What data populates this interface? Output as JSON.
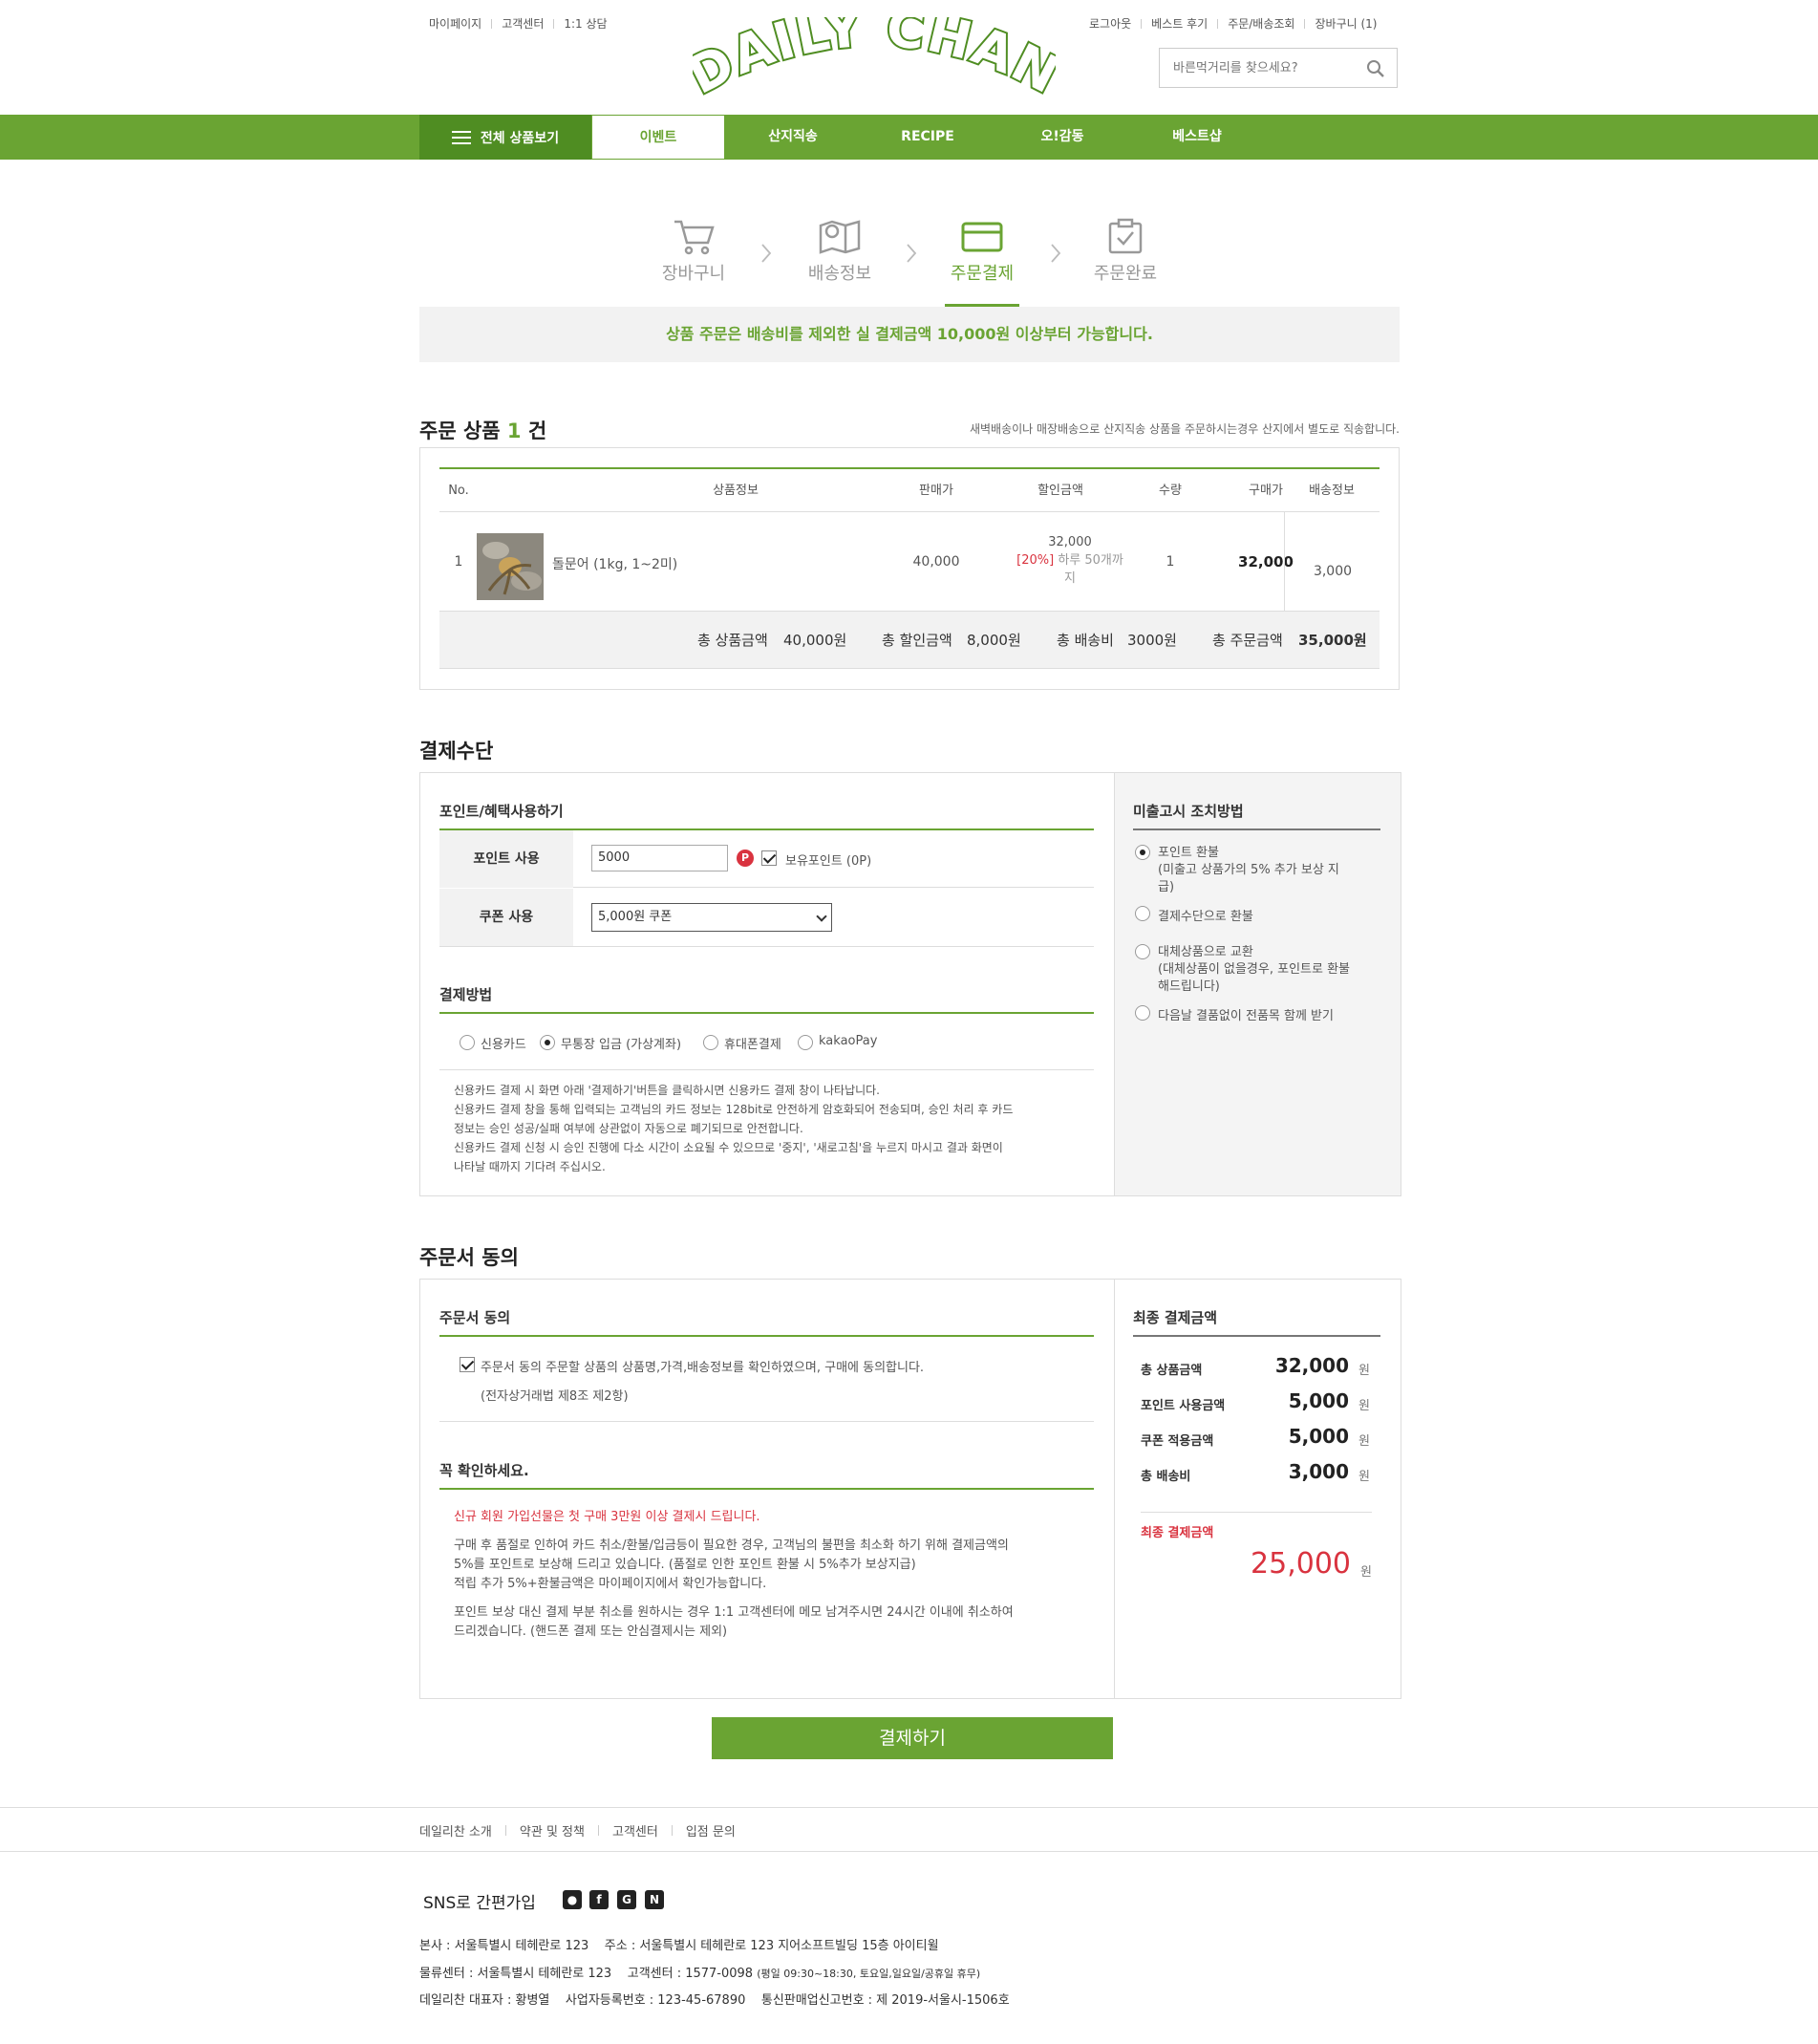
{
  "header": {
    "util_left": [
      "마이페이지",
      "고객센터",
      "1:1 상담"
    ],
    "util_right": [
      "로그아웃",
      "베스트 후기",
      "주문/배송조회",
      "장바구니 (1)"
    ],
    "logo_text": "DAILY CHAN",
    "search_placeholder": "바른먹거리를 찾으세요?"
  },
  "gnb": {
    "all_label": "전체 상품보기",
    "menus": [
      "이벤트",
      "산지직송",
      "RECIPE",
      "오!감동",
      "베스트샵"
    ],
    "active_index": 0
  },
  "steps": {
    "items": [
      "장바구니",
      "배송정보",
      "주문결제",
      "주문완료"
    ],
    "active_index": 2
  },
  "notice": "상품 주문은 배송비를 제외한 실 결제금액 10,000원 이상부터 가능합니다.",
  "order": {
    "title_prefix": "주문 상품",
    "count": "1",
    "title_suffix": "건",
    "note": "새벽배송이나 매장배송으로 산지직송 상품을 주문하시는경우 산지에서 별도로 직송합니다.",
    "columns": [
      "No.",
      "상품정보",
      "판매가",
      "할인금액",
      "수량",
      "구매가",
      "배송정보"
    ],
    "rows": [
      {
        "no": "1",
        "name": "돌문어 (1kg, 1~2미)",
        "price": "40,000",
        "discount": "32,000",
        "discount_rate": "[20%]",
        "discount_note_1": "하루 50개까",
        "discount_note_2": "지",
        "qty": "1",
        "buy_price": "32,000",
        "ship": "3,000"
      }
    ],
    "totals": {
      "product_label": "총 상품금액",
      "product_value": "40,000원",
      "discount_label": "총 할인금액",
      "discount_value": "8,000원",
      "ship_label": "총 배송비",
      "ship_value": "3000원",
      "order_label": "총 주문금액",
      "order_value": "35,000원"
    }
  },
  "payment": {
    "section_title": "결제수단",
    "points_title": "포인트/혜택사용하기",
    "point_label": "포인트 사용",
    "point_value": "5000",
    "point_badge": "P",
    "point_hold_label": "보유포인트 (0P)",
    "coupon_label": "쿠폰 사용",
    "coupon_selected": "5,000원 쿠폰",
    "method_title": "결제방법",
    "methods": [
      "신용카드",
      "무통장 입금 (가상계좌)",
      "휴대폰결제",
      "kakaoPay"
    ],
    "method_selected": 1,
    "guide": [
      "신용카드 결제 시 화면 아래 '결제하기'버튼을 클릭하시면 신용카드 결제 창이 나타납니다.",
      "신용카드 결제 창을 통해 입력되는 고객님의 카드 정보는 128bit로 안전하게 암호화되어 전송되며, 승인 처리 후 카드",
      "정보는 승인 성공/실패 여부에 상관없이 자동으로 폐기되므로 안전합니다.",
      "신용카드 결제 신청 시 승인 진행에 다소 시간이 소요될 수 있으므로 '중지', '새로고침'을 누르지 마시고 결과 화면이",
      "나타날 때까지 기다려 주십시오."
    ],
    "shortage_title": "미출고시 조치방법",
    "shortage_options": [
      {
        "l1": "포인트 환불",
        "l2": "(미출고 상품가의 5% 추가 보상 지",
        "l3": "급)"
      },
      {
        "l1": "결제수단으로 환불",
        "l2": "",
        "l3": ""
      },
      {
        "l1": "대체상품으로 교환",
        "l2": "(대체상품이 없을경우, 포인트로 환불",
        "l3": "해드립니다)"
      },
      {
        "l1": "다음날 결품없이 전품목 함께 받기",
        "l2": "",
        "l3": ""
      }
    ],
    "shortage_selected": 0
  },
  "agree": {
    "section_title": "주문서 동의",
    "box_title": "주문서 동의",
    "agree_text": "주문서 동의 주문할 상품의 상품명,가격,배송정보를 확인하였으며, 구매에 동의합니다.",
    "agree_law": "(전자상거래법 제8조 제2항)",
    "check_title": "꼭 확인하세요.",
    "check_red": "신규 회원 가입선물은 첫 구매 3만원 이상 결제시 드립니다.",
    "check_p1": [
      "구매 후 품절로 인하여 카드 취소/환불/입금등이 필요한 경우, 고객님의 불편을 최소화 하기 위해 결제금액의",
      "5%를 포인트로 보상해 드리고 있습니다. (품절로 인한 포인트 환불 시 5%추가 보상지급)",
      "적립 추가 5%+환불금액은 마이페이지에서 확인가능합니다."
    ],
    "check_p2": [
      "포인트 보상 대신 결제 부분 취소를 원하시는 경우 1:1 고객센터에 메모 남겨주시면 24시간 이내에 취소하여",
      "드리겠습니다. (핸드폰 결제 또는 안심결제시는 제외)"
    ]
  },
  "final": {
    "title": "최종 결제금액",
    "rows": [
      {
        "label": "총 상품금액",
        "value": "32,000",
        "unit": "원"
      },
      {
        "label": "포인트 사용금액",
        "value": "5,000",
        "unit": "원"
      },
      {
        "label": "쿠폰 적용금액",
        "value": "5,000",
        "unit": "원"
      },
      {
        "label": "총 배송비",
        "value": "3,000",
        "unit": "원"
      }
    ],
    "total_label": "최종 결제금액",
    "total_value": "25,000",
    "total_unit": "원",
    "pay_button": "결제하기"
  },
  "footer": {
    "links": [
      "데일리찬 소개",
      "약관 및 정책",
      "고객센터",
      "입점 문의"
    ],
    "sns_label": "SNS로 간편가입",
    "sns_icons": [
      "kakao-icon",
      "facebook-icon",
      "google-icon",
      "naver-icon"
    ],
    "sns_glyphs": [
      "●",
      "f",
      "G",
      "N"
    ],
    "info1": "본사 : 서울특별시 테헤란로 123    주소 : 서울특별시 테헤란로 123 지어소프트빌딩 15층 아이티윌",
    "info2_a": "물류센터 : 서울특별시 테헤란로 123    고객센터 : 1577-0098 ",
    "info2_b": "(평일 09:30~18:30, 토요일,일요일/공휴일 휴무)",
    "info3": "데일리찬 대표자 : 황병열    사업자등록번호 : 123-45-67890    통신판매업신고번호 : 제 2019-서울시-1506호"
  },
  "colors": {
    "brand_green": "#6aa433",
    "brand_green_dark": "#4f8d22",
    "accent_red": "#d9333f"
  }
}
